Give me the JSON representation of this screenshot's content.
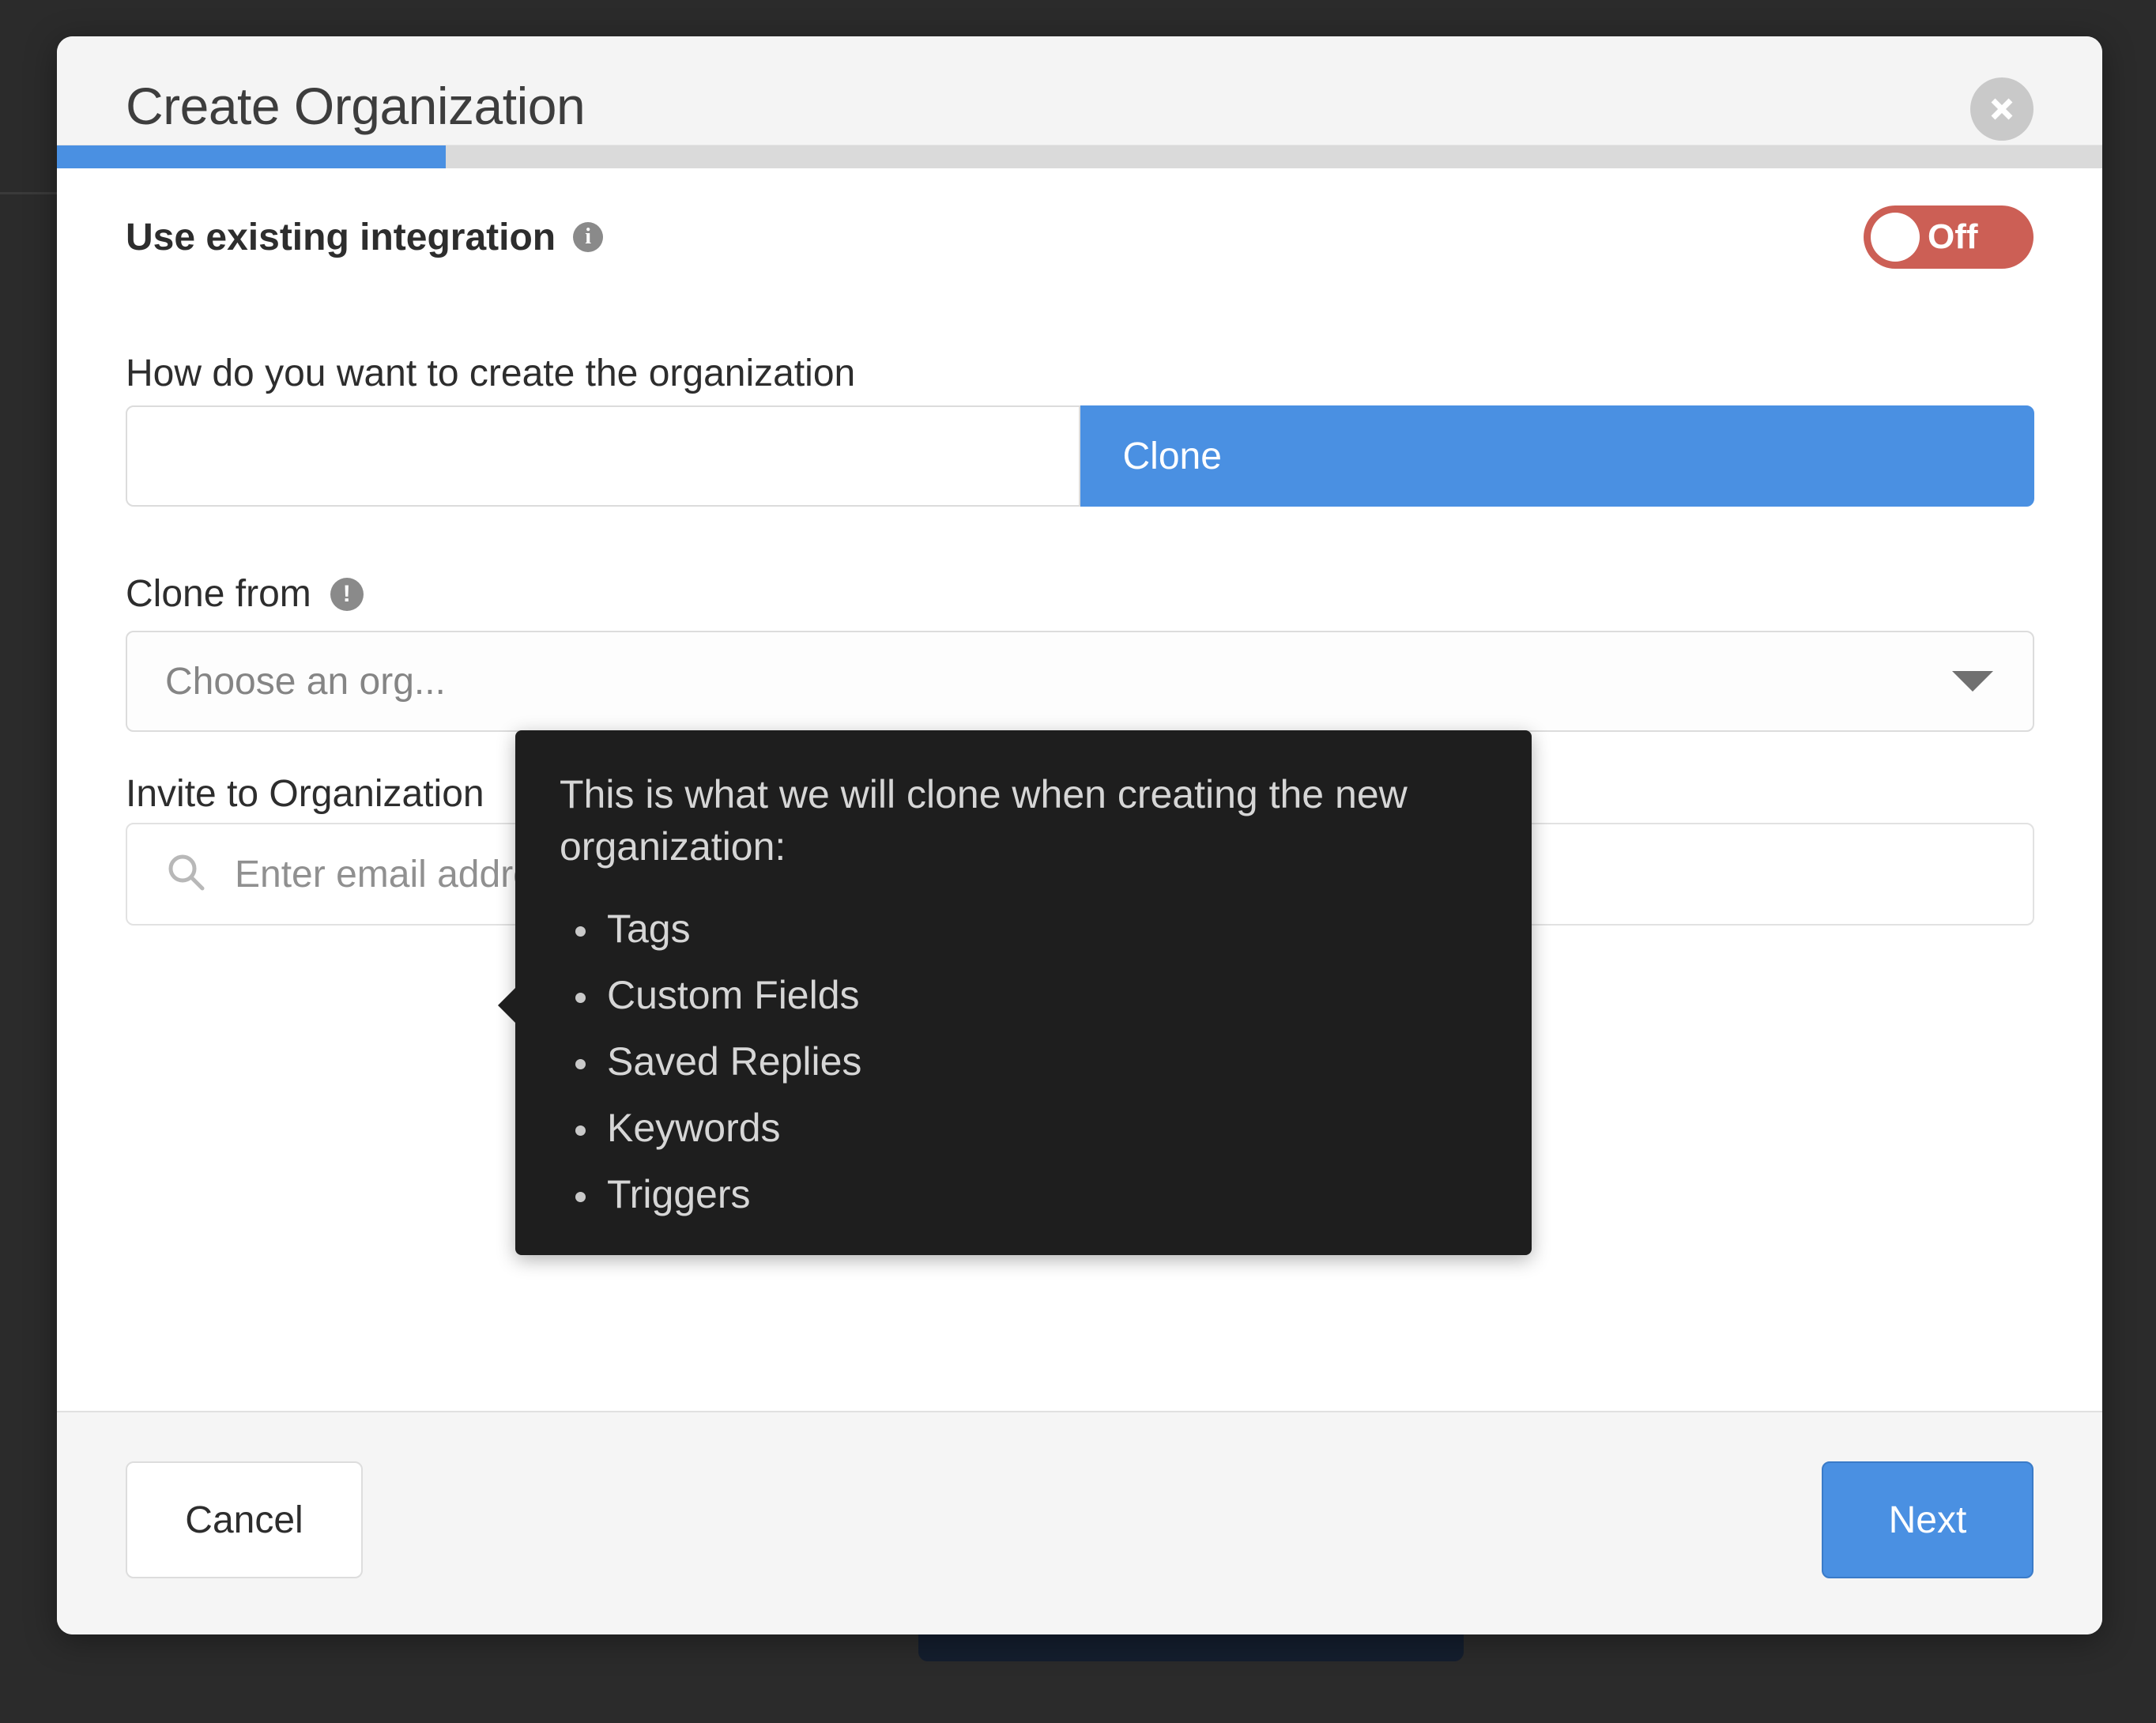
{
  "backdrop": {
    "color": "#2b2b2b"
  },
  "modal": {
    "title": "Create Organization",
    "close_icon": "close-icon",
    "progress": {
      "percent": 19,
      "fill_color": "#4a90e2",
      "track_color": "#dadada"
    },
    "integration": {
      "label": "Use existing integration",
      "info_icon": "info-icon",
      "info_glyph": "i",
      "toggle": {
        "state_label": "Off",
        "on": false,
        "off_color": "#cc5f55"
      }
    },
    "create_mode": {
      "label": "How do you want to create the organization",
      "options": [
        {
          "label": "",
          "active": false
        },
        {
          "label": "Clone",
          "active": true
        }
      ]
    },
    "clone_from": {
      "label": "Clone from",
      "warning_icon": "exclamation-icon",
      "warning_glyph": "!",
      "select_placeholder": "Choose an org...",
      "caret_icon": "chevron-down-icon"
    },
    "invite": {
      "label": "Invite to Organization",
      "search_icon": "search-icon",
      "input_value": "",
      "input_placeholder": "Enter email address or name"
    },
    "footer": {
      "cancel_label": "Cancel",
      "next_label": "Next",
      "next_color": "#4a90e2"
    }
  },
  "tooltip": {
    "intro": "This is what we will clone when creating the new organization:",
    "items": [
      "Tags",
      "Custom Fields",
      "Saved Replies",
      "Keywords",
      "Triggers"
    ],
    "background": "#1e1e1e",
    "text_color": "#d6d6d6"
  }
}
